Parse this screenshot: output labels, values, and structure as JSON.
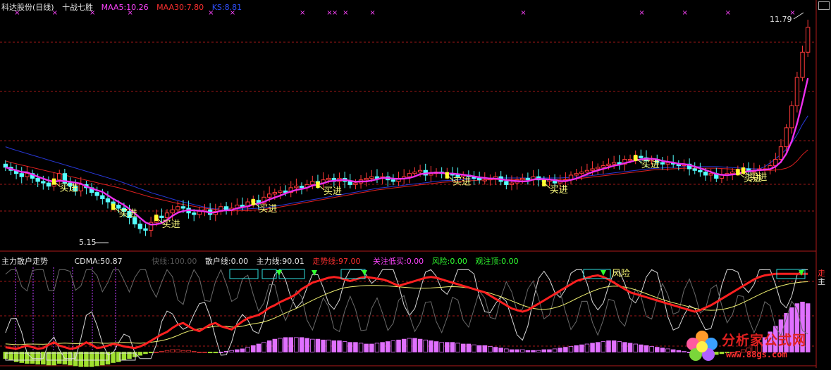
{
  "top_header": {
    "title": "科达股份(日线)",
    "strategy": "十战七胜",
    "ma5": "MAA5:10.26",
    "ma30": "MAA30:7.80",
    "ks": "KS:8.81",
    "colors": {
      "title": "#e6e6e6",
      "strategy": "#e6e6e6",
      "ma5": "#ff44ff",
      "ma30": "#ff3030",
      "ks": "#3050ff"
    }
  },
  "bottom_header": {
    "title": "主力散户走势",
    "cdma": "CDMA:50.87",
    "fast": "快线:100.00",
    "retail": "散户线:0.00",
    "main": "主力线:90.01",
    "trend": "走势线:97.00",
    "watch_buy": "关注低买:0.00",
    "risk": "风险:0.00",
    "watch_top": "观注顶:0.00",
    "colors": {
      "title": "#e6e6e6",
      "cdma": "#e6e6e6",
      "fast": "#555555",
      "retail": "#e6e6e6",
      "main": "#e6e6e6",
      "trend": "#ff3030",
      "watch_buy": "#ff44ff",
      "risk": "#30ff30",
      "watch_top": "#30ff30"
    }
  },
  "annotations": {
    "high_label": "11.79",
    "low_label": "5.15",
    "buy_label": "买进",
    "risk_label": "风险",
    "right_cut_1": "走",
    "right_cut_2": "主"
  },
  "watermark": {
    "title": "分析家公式网",
    "url": "www.88gs.com"
  },
  "chart_data": [
    {
      "type": "candlestick",
      "title": "科达股份(日线)",
      "ylim": [
        4.8,
        12.3
      ],
      "y_max_label": 11.79,
      "y_min_label": 5.15,
      "count": 150,
      "close": [
        7.35,
        7.25,
        7.15,
        7.05,
        7.15,
        7.0,
        6.9,
        6.85,
        6.75,
        6.95,
        7.15,
        6.85,
        6.75,
        6.6,
        6.8,
        6.7,
        6.55,
        6.45,
        6.35,
        6.25,
        6.15,
        6.05,
        5.95,
        5.75,
        5.55,
        5.4,
        5.35,
        5.6,
        5.8,
        5.75,
        5.9,
        6.0,
        6.1,
        6.05,
        5.9,
        5.85,
        5.95,
        6.0,
        5.85,
        5.95,
        6.1,
        6.0,
        6.05,
        6.15,
        6.1,
        6.25,
        6.3,
        6.2,
        6.4,
        6.5,
        6.55,
        6.6,
        6.55,
        6.7,
        6.75,
        6.7,
        6.8,
        6.9,
        6.85,
        6.95,
        7.0,
        6.9,
        7.0,
        6.9,
        6.8,
        6.85,
        6.95,
        7.0,
        7.05,
        7.0,
        7.05,
        6.95,
        6.9,
        7.0,
        7.05,
        7.15,
        7.2,
        7.25,
        7.1,
        7.15,
        7.2,
        7.15,
        7.15,
        7.1,
        7.05,
        7.1,
        7.05,
        7.0,
        6.95,
        6.95,
        7.0,
        7.05,
        6.9,
        6.8,
        6.85,
        6.95,
        7.0,
        6.95,
        7.05,
        6.95,
        6.9,
        6.95,
        6.85,
        6.9,
        6.95,
        7.1,
        7.15,
        7.2,
        7.25,
        7.3,
        7.35,
        7.4,
        7.45,
        7.5,
        7.45,
        7.6,
        7.6,
        7.7,
        7.65,
        7.55,
        7.6,
        7.5,
        7.45,
        7.5,
        7.45,
        7.4,
        7.45,
        7.3,
        7.25,
        7.2,
        7.1,
        7.15,
        7.0,
        7.1,
        7.15,
        7.2,
        7.25,
        7.3,
        7.2,
        7.25,
        7.3,
        7.3,
        7.4,
        7.6,
        8.0,
        8.6,
        9.3,
        10.2,
        11.0,
        11.79
      ],
      "open": [
        7.45,
        7.35,
        7.25,
        7.15,
        7.05,
        7.15,
        7.0,
        6.9,
        6.85,
        6.75,
        6.95,
        7.15,
        6.85,
        6.75,
        6.6,
        6.8,
        6.7,
        6.55,
        6.45,
        6.35,
        6.25,
        6.15,
        6.05,
        5.95,
        5.75,
        5.55,
        5.4,
        5.35,
        5.6,
        5.8,
        5.75,
        5.9,
        6.0,
        6.1,
        6.05,
        5.9,
        5.85,
        5.95,
        6.0,
        5.85,
        5.95,
        6.1,
        6.0,
        6.05,
        6.15,
        6.1,
        6.25,
        6.3,
        6.2,
        6.4,
        6.5,
        6.55,
        6.6,
        6.55,
        6.7,
        6.75,
        6.7,
        6.8,
        6.9,
        6.85,
        6.95,
        7.0,
        6.9,
        7.0,
        6.9,
        6.8,
        6.85,
        6.95,
        7.0,
        7.05,
        7.0,
        7.05,
        6.95,
        6.9,
        7.0,
        7.05,
        7.15,
        7.2,
        7.25,
        7.1,
        7.15,
        7.2,
        7.15,
        7.15,
        7.1,
        7.05,
        7.1,
        7.05,
        7.0,
        6.95,
        6.95,
        7.0,
        7.05,
        6.9,
        6.8,
        6.85,
        6.95,
        7.0,
        6.95,
        7.05,
        6.95,
        6.9,
        6.95,
        6.85,
        6.9,
        6.95,
        7.1,
        7.15,
        7.2,
        7.25,
        7.3,
        7.35,
        7.4,
        7.45,
        7.5,
        7.45,
        7.6,
        7.6,
        7.7,
        7.65,
        7.55,
        7.6,
        7.5,
        7.45,
        7.5,
        7.45,
        7.4,
        7.45,
        7.3,
        7.25,
        7.2,
        7.1,
        7.15,
        7.0,
        7.1,
        7.15,
        7.2,
        7.25,
        7.3,
        7.2,
        7.25,
        7.3,
        7.3,
        7.4,
        7.6,
        8.0,
        8.6,
        9.3,
        10.2,
        11.0
      ],
      "ma30": [
        7.55,
        7.5,
        7.46,
        7.42,
        7.38,
        7.34,
        7.3,
        7.26,
        7.22,
        7.18,
        7.14,
        7.1,
        7.06,
        7.02,
        6.98,
        6.94,
        6.9,
        6.86,
        6.82,
        6.78,
        6.74,
        6.7,
        6.65,
        6.6,
        6.55,
        6.5,
        6.45,
        6.4,
        6.36,
        6.32,
        6.28,
        6.24,
        6.2,
        6.17,
        6.14,
        6.11,
        6.08,
        6.05,
        6.03,
        6.01,
        5.99,
        5.98,
        5.97,
        5.97,
        5.97,
        5.98,
        5.99,
        6.0,
        6.02,
        6.04,
        6.06,
        6.09,
        6.12,
        6.15,
        6.18,
        6.21,
        6.24,
        6.27,
        6.3,
        6.33,
        6.36,
        6.39,
        6.42,
        6.45,
        6.48,
        6.51,
        6.54,
        6.57,
        6.6,
        6.63,
        6.65,
        6.67,
        6.69,
        6.71,
        6.73,
        6.75,
        6.77,
        6.79,
        6.81,
        6.83,
        6.85,
        6.87,
        6.88,
        6.89,
        6.9,
        6.91,
        6.92,
        6.93,
        6.94,
        6.95,
        6.96,
        6.96,
        6.96,
        6.96,
        6.96,
        6.96,
        6.96,
        6.96,
        6.96,
        6.96,
        6.96,
        6.96,
        6.96,
        6.96,
        6.97,
        6.98,
        6.99,
        7.0,
        7.02,
        7.04,
        7.06,
        7.08,
        7.1,
        7.12,
        7.14,
        7.16,
        7.18,
        7.2,
        7.22,
        7.24,
        7.26,
        7.27,
        7.28,
        7.29,
        7.3,
        7.31,
        7.32,
        7.32,
        7.32,
        7.32,
        7.32,
        7.32,
        7.32,
        7.31,
        7.3,
        7.29,
        7.28,
        7.27,
        7.26,
        7.25,
        7.25,
        7.25,
        7.25,
        7.26,
        7.28,
        7.32,
        7.4,
        7.55,
        7.75,
        7.9
      ]
    },
    {
      "type": "bar",
      "title": "主力散户走势",
      "count": 150,
      "ylim": [
        -10,
        105
      ],
      "series": [
        {
          "name": "散户线",
          "values": [
            -8,
            -10,
            -12,
            -13,
            -14,
            -14,
            -15,
            -15,
            -16,
            -16,
            -14,
            -15,
            -16,
            -17,
            -18,
            -18,
            -18,
            -17,
            -16,
            -15,
            -13,
            -12,
            -10,
            -8,
            -6,
            -4,
            -2,
            -1,
            0,
            1,
            2,
            3,
            3,
            2,
            2,
            1,
            0,
            0,
            -1,
            -1,
            0,
            1,
            2,
            3,
            4,
            6,
            8,
            10,
            12,
            14,
            16,
            17,
            18,
            18,
            18,
            18,
            17,
            16,
            16,
            15,
            15,
            14,
            14,
            13,
            12,
            12,
            11,
            10,
            10,
            11,
            12,
            13,
            14,
            15,
            16,
            17,
            17,
            16,
            15,
            14,
            13,
            12,
            12,
            12,
            11,
            10,
            10,
            9,
            8,
            8,
            7,
            6,
            5,
            4,
            3,
            3,
            3,
            2,
            2,
            2,
            3,
            3,
            4,
            5,
            6,
            7,
            8,
            9,
            10,
            11,
            12,
            13,
            14,
            14,
            13,
            12,
            11,
            10,
            9,
            8,
            7,
            6,
            5,
            4,
            3,
            2,
            1,
            0,
            -1,
            -2,
            -3,
            -4,
            -3,
            -2,
            -1,
            0,
            1,
            3,
            5,
            8,
            12,
            18,
            25,
            32,
            40,
            48,
            55,
            60,
            62,
            60
          ]
        },
        {
          "name": "走势线",
          "values": [
            6,
            5,
            4,
            6,
            8,
            6,
            4,
            5,
            9,
            12,
            8,
            6,
            4,
            5,
            8,
            12,
            9,
            5,
            6,
            8,
            10,
            9,
            7,
            6,
            5,
            7,
            10,
            14,
            18,
            22,
            25,
            30,
            34,
            36,
            32,
            28,
            26,
            30,
            34,
            36,
            32,
            30,
            28,
            33,
            38,
            42,
            44,
            46,
            50,
            55,
            58,
            62,
            65,
            68,
            72,
            78,
            82,
            86,
            88,
            90,
            92,
            93,
            92,
            90,
            88,
            90,
            92,
            93,
            92,
            91,
            90,
            88,
            85,
            82,
            84,
            86,
            88,
            90,
            92,
            93,
            92,
            90,
            88,
            86,
            84,
            82,
            80,
            78,
            76,
            74,
            70,
            66,
            62,
            58,
            54,
            52,
            50,
            52,
            56,
            60,
            64,
            68,
            72,
            76,
            80,
            84,
            88,
            90,
            92,
            94,
            95,
            93,
            90,
            86,
            82,
            78,
            74,
            72,
            70,
            68,
            66,
            64,
            62,
            60,
            58,
            56,
            54,
            52,
            50,
            52,
            55,
            58,
            62,
            66,
            70,
            74,
            78,
            82,
            86,
            90,
            93,
            95,
            96,
            97,
            97,
            97,
            97,
            97,
            97,
            97
          ]
        }
      ]
    }
  ]
}
